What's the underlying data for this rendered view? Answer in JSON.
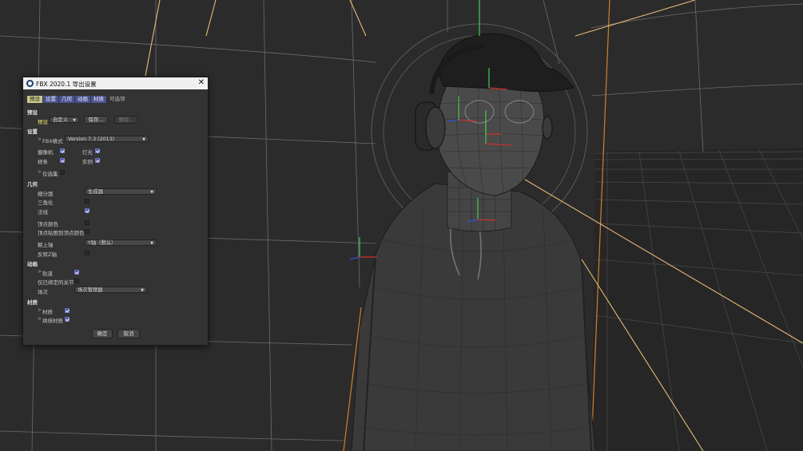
{
  "dialog": {
    "title": "FBX 2020.1 导出设置",
    "close_glyph": "✕",
    "tabs": [
      "预设",
      "设置",
      "几何",
      "动画",
      "材质",
      "可选项"
    ],
    "presets": {
      "section": "预设",
      "preset_label": "预设",
      "preset_value": "自定义",
      "save_button": "保存...",
      "delete_button": "删除..."
    },
    "settings": {
      "section": "设置",
      "fbx_format_label": "FBX格式",
      "fbx_format_value": "Version 7.3 (2013)",
      "camera_label": "摄像机",
      "camera_checked": true,
      "light_label": "灯光",
      "light_checked": true,
      "spline_label": "样条",
      "spline_checked": true,
      "instance_label": "实例",
      "instance_checked": true,
      "selection_label": "仅选集",
      "selection_checked": false
    },
    "geometry": {
      "section": "几何",
      "subdivision_label": "细分面",
      "subdivision_value": "生成器",
      "triangulate_label": "三角化",
      "triangulate_checked": false,
      "normals_label": "法线",
      "normals_checked": true,
      "vertex_color_label": "顶点颜色",
      "vertex_color_checked": false,
      "vertex_map_label": "顶点贴图到顶点颜色",
      "vertex_map_checked": false,
      "up_axis_label": "朝上轴",
      "up_axis_value": "Y轴（默认）",
      "flip_z_label": "反转Z轴",
      "flip_z_checked": false
    },
    "animation": {
      "section": "动画",
      "tracks_label": "轨道",
      "tracks_checked": true,
      "bound_joints_label": "仅已绑定的关节",
      "bound_joints_checked": false,
      "takes_label": "场次",
      "takes_value": "场次管理器"
    },
    "materials": {
      "section": "材质",
      "materials_label": "材质",
      "materials_checked": true,
      "baked_label": "烘焙材质",
      "baked_checked": true
    },
    "ok_button": "确定",
    "cancel_button": "取消"
  },
  "colors": {
    "viewport_bg": "#2b2b2b",
    "grid_line": "#7a7a7a",
    "light_line": "#e8b878",
    "selection_edge": "#d08030",
    "tab_active": "#c9c98a",
    "tab_inactive": "#4a5290",
    "checkbox_on": "#4f5aa8"
  },
  "icons": {
    "app_logo": "cinema4d-logo-icon",
    "close": "close-icon",
    "dropdown": "chevron-down-icon",
    "expand": "chevron-right-icon"
  }
}
